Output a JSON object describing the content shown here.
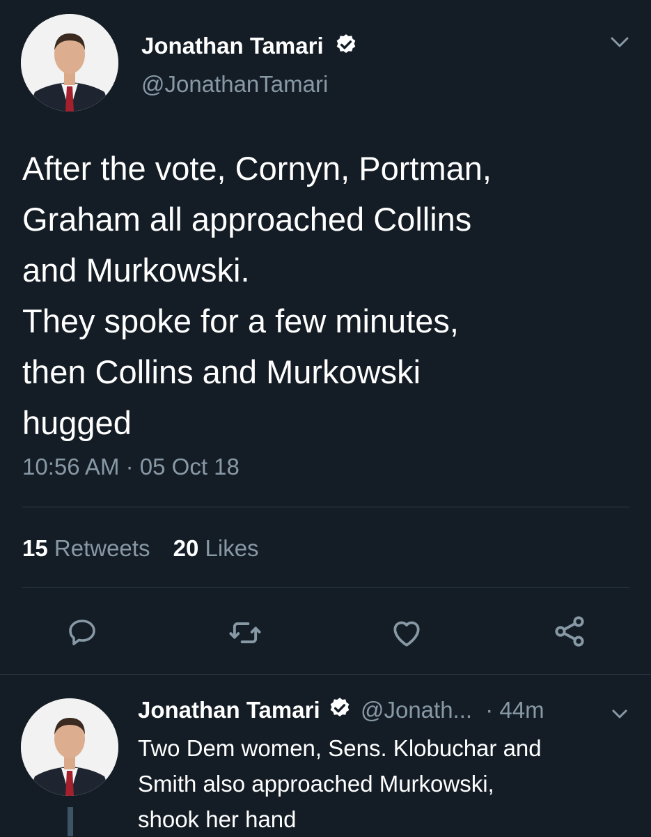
{
  "main_tweet": {
    "author_name": "Jonathan Tamari",
    "handle": "@JonathanTamari",
    "text_lines": [
      "After the vote, Cornyn, Portman,",
      "Graham all approached Collins",
      "and Murkowski.",
      "They spoke for a few minutes,",
      "then Collins and Murkowski",
      "hugged"
    ],
    "time": "10:56 AM",
    "separator": "·",
    "date": "05 Oct 18",
    "retweets_count": "15",
    "retweets_label": "Retweets",
    "likes_count": "20",
    "likes_label": "Likes"
  },
  "reply_tweet": {
    "author_name": "Jonathan Tamari",
    "handle": "@Jonath...",
    "time_ago": "· 44m",
    "text_lines": [
      "Two Dem women, Sens. Klobuchar and",
      "Smith also approached Murkowski,",
      "shook her hand"
    ]
  },
  "colors": {
    "background": "#141d26",
    "muted": "#8899a6",
    "divider": "#2c3a48"
  },
  "icons": [
    "verified-badge-icon",
    "chevron-down-icon",
    "reply-icon",
    "retweet-icon",
    "like-icon",
    "share-icon"
  ]
}
